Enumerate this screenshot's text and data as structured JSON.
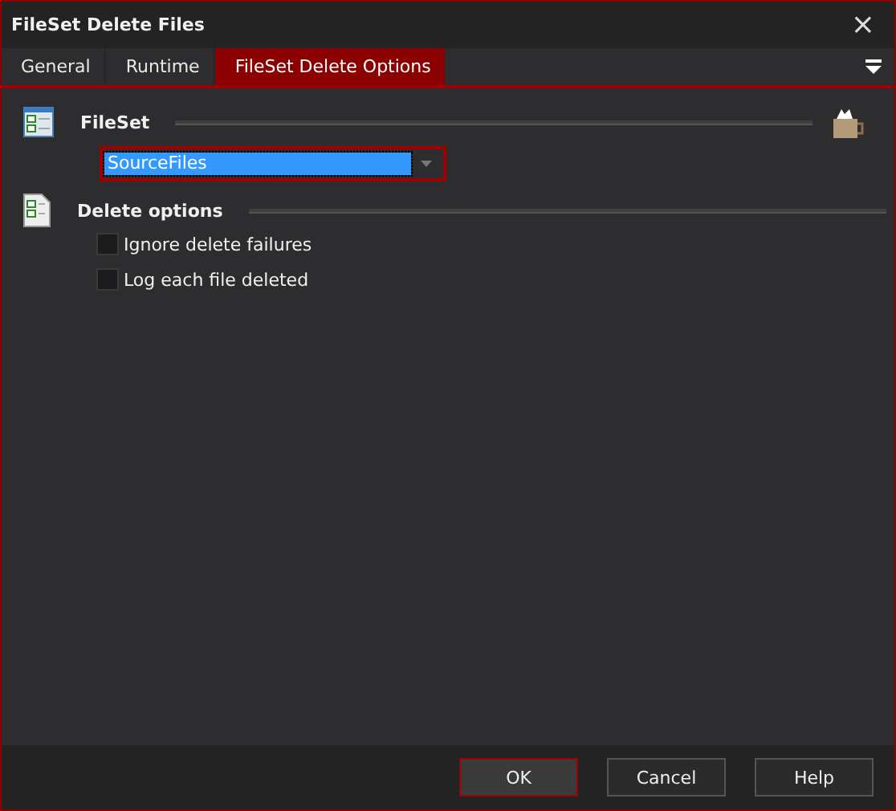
{
  "window": {
    "title": "FileSet Delete Files",
    "close": "×"
  },
  "tabs": [
    {
      "label": "General",
      "selected": false
    },
    {
      "label": "Runtime",
      "selected": false
    },
    {
      "label": "FileSet Delete Options",
      "selected": true
    }
  ],
  "fileset": {
    "heading": "FileSet",
    "value": "SourceFiles"
  },
  "delete_options": {
    "heading": "Delete options",
    "options": [
      {
        "label": "Ignore delete failures",
        "checked": false
      },
      {
        "label": "Log each file deleted",
        "checked": false
      }
    ]
  },
  "buttons": [
    {
      "label": "OK",
      "selected": true
    },
    {
      "label": "Cancel",
      "selected": false
    },
    {
      "label": "Help",
      "selected": false
    }
  ]
}
